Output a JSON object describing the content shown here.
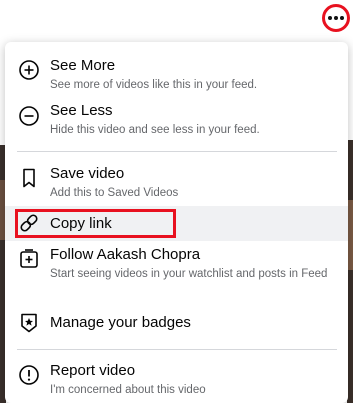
{
  "menu": {
    "items": [
      {
        "title": "See More",
        "desc": "See more of videos like this in your feed.",
        "icon": "plus-circle-icon"
      },
      {
        "title": "See Less",
        "desc": "Hide this video and see less in your feed.",
        "icon": "minus-circle-icon"
      },
      {
        "title": "Save video",
        "desc": "Add this to Saved Videos",
        "icon": "bookmark-icon"
      },
      {
        "title": "Copy link",
        "desc": "",
        "icon": "link-icon"
      },
      {
        "title": "Follow Aakash Chopra",
        "desc": "Start seeing videos in your watchlist and posts in Feed",
        "icon": "follow-icon"
      },
      {
        "title": "Manage your badges",
        "desc": "",
        "icon": "badge-icon"
      },
      {
        "title": "Report video",
        "desc": "I'm concerned about this video",
        "icon": "report-icon"
      }
    ]
  },
  "colors": {
    "highlight": "#e8111f",
    "text": "#050505",
    "secondary": "#65676b"
  }
}
